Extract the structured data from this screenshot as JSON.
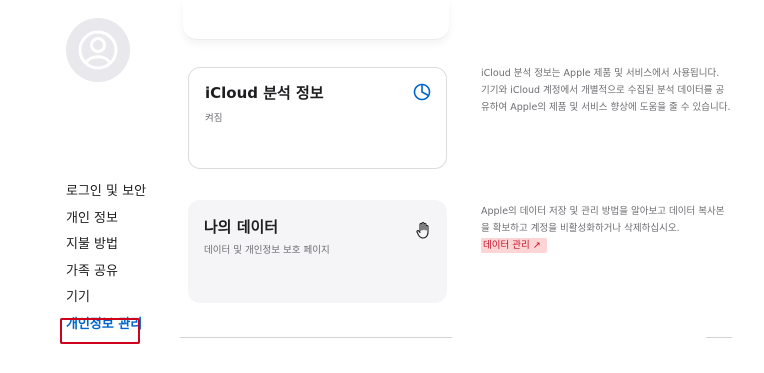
{
  "sidebar": {
    "items": [
      {
        "label": "로그인 및 보안"
      },
      {
        "label": "개인 정보"
      },
      {
        "label": "지불 방법"
      },
      {
        "label": "가족 공유"
      },
      {
        "label": "기기"
      },
      {
        "label": "개인정보 관리",
        "active": true
      }
    ]
  },
  "cards": {
    "icloud_analytics": {
      "title": "iCloud 분석 정보",
      "status": "켜짐",
      "icon": "pie-chart-icon",
      "description": "iCloud 분석 정보는 Apple 제품 및 서비스에서 사용됩니다. 기기와 iCloud 계정에서 개별적으로 수집된 분석 데이터를 공유하여 Apple의 제품 및 서비스 향상에 도움을 줄 수 있습니다."
    },
    "my_data": {
      "title": "나의 데이터",
      "subtitle": "데이터 및 개인정보 보호 페이지",
      "icon": "hand-icon",
      "description": "Apple의 데이터 저장 및 관리 방법을 알아보고 데이터 복사본을 확보하고 계정을 비활성화하거나 삭제하십시오.",
      "link_label": "데이터 관리 ↗"
    }
  },
  "colors": {
    "accent": "#0066cc",
    "highlight_border": "#d0021b",
    "link_highlight": "#fdd5d5"
  }
}
